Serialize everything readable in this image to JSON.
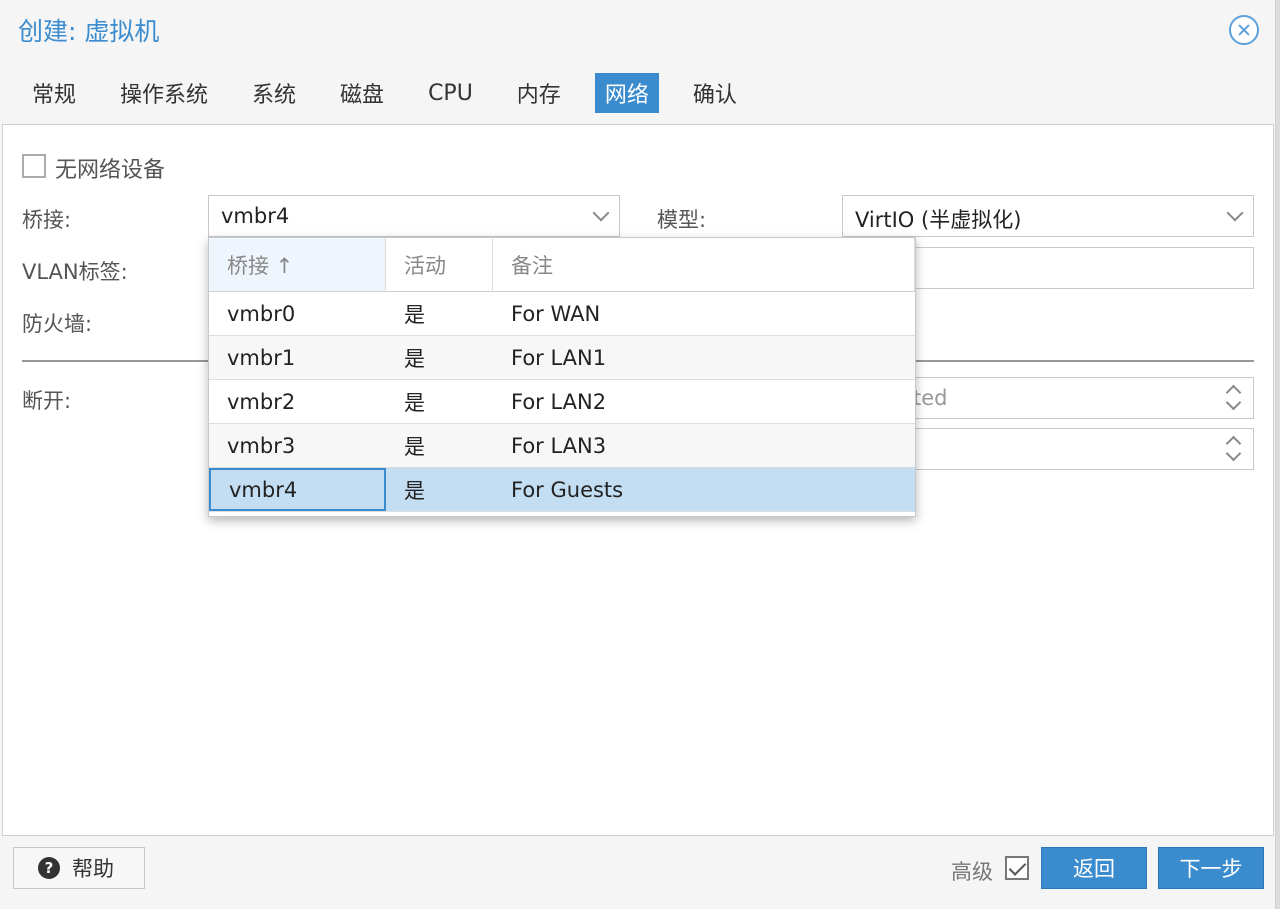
{
  "window": {
    "title": "创建: 虚拟机"
  },
  "tabs": [
    {
      "label": "常规",
      "active": false
    },
    {
      "label": "操作系统",
      "active": false
    },
    {
      "label": "系统",
      "active": false
    },
    {
      "label": "磁盘",
      "active": false
    },
    {
      "label": "CPU",
      "active": false
    },
    {
      "label": "内存",
      "active": false
    },
    {
      "label": "网络",
      "active": true
    },
    {
      "label": "确认",
      "active": false
    }
  ],
  "form": {
    "no_network_label": "无网络设备",
    "bridge_label": "桥接:",
    "bridge_value": "vmbr4",
    "model_label": "模型:",
    "model_value": "VirtIO (半虚拟化)",
    "vlan_label": "VLAN标签:",
    "firewall_label": "防火墙:",
    "disconnect_label": "断开:",
    "rate_limit_partial": "ted"
  },
  "bridge_grid": {
    "columns": [
      "桥接 ↑",
      "活动",
      "备注"
    ],
    "rows": [
      {
        "bridge": "vmbr0",
        "active": "是",
        "comment": "For WAN"
      },
      {
        "bridge": "vmbr1",
        "active": "是",
        "comment": "For LAN1"
      },
      {
        "bridge": "vmbr2",
        "active": "是",
        "comment": "For LAN2"
      },
      {
        "bridge": "vmbr3",
        "active": "是",
        "comment": "For LAN3"
      },
      {
        "bridge": "vmbr4",
        "active": "是",
        "comment": "For Guests"
      }
    ],
    "selected_index": 4
  },
  "footer": {
    "help_label": "帮助",
    "advanced_label": "高级",
    "back_label": "返回",
    "next_label": "下一步"
  },
  "colors": {
    "accent": "#3a8ccf",
    "selected_row": "#c3ddf2"
  }
}
